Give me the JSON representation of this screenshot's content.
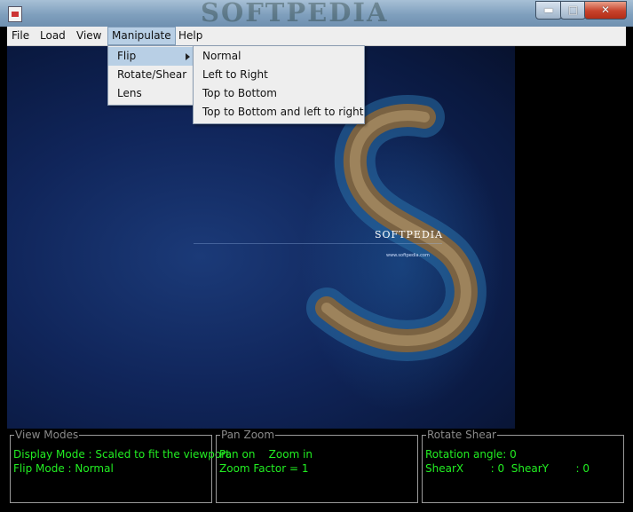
{
  "window": {
    "watermark": "SOFTPEDIA",
    "controls": {
      "minimize": "▬",
      "maximize": "□",
      "close": "✕"
    }
  },
  "menubar": {
    "items": [
      "File",
      "Load",
      "View",
      "Manipulate",
      "Help"
    ]
  },
  "manipulate_menu": {
    "items": [
      "Flip",
      "Rotate/Shear",
      "Lens"
    ]
  },
  "flip_submenu": {
    "items": [
      "Normal",
      "Left to Right",
      "Top to Bottom",
      "Top to Bottom and left to right"
    ]
  },
  "image": {
    "brand": "SOFTPEDIA",
    "url": "www.softpedia.com"
  },
  "panels": {
    "view_modes": {
      "title": "View Modes",
      "lines": [
        "Display Mode : Scaled to fit the viewport",
        "Flip Mode : Normal"
      ]
    },
    "pan_zoom": {
      "title": "Pan Zoom",
      "lines": [
        "Pan on    Zoom in",
        "Zoom Factor = 1"
      ]
    },
    "rotate_shear": {
      "title": "Rotate Shear",
      "lines": [
        "Rotation angle: 0",
        "ShearX        : 0  ShearY        : 0"
      ]
    }
  },
  "colors": {
    "status_text": "#22ee22",
    "menu_highlight": "#b8cfe5",
    "title_bar": "#7f9fbd"
  }
}
